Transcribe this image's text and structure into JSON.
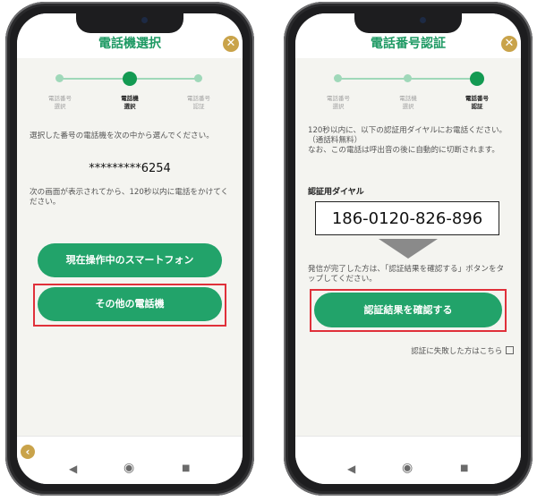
{
  "left": {
    "title": "電話機選択",
    "steps": [
      {
        "label": "電話番号\n選択",
        "active": false
      },
      {
        "label": "電話機\n選択",
        "active": true
      },
      {
        "label": "電話番号\n認証",
        "active": false
      }
    ],
    "instruction": "選択した番号の電話機を次の中から選んでください。",
    "masked_number": "*********6254",
    "note": "次の画面が表示されてから、120秒以内に電話をかけてください。",
    "btn_current": "現在操作中のスマートフォン",
    "btn_other": "その他の電話機"
  },
  "right": {
    "title": "電話番号認証",
    "steps": [
      {
        "label": "電話番号\n選択",
        "active": false
      },
      {
        "label": "電話機\n選択",
        "active": false
      },
      {
        "label": "電話番号\n認証",
        "active": true
      }
    ],
    "instruction": "120秒以内に、以下の認証用ダイヤルにお電話ください。（通話料無料）\nなお、この電話は呼出音の後に自動的に切断されます。",
    "dial_label": "認証用ダイヤル",
    "dial_number": "186-0120-826-896",
    "after_call_note": "発信が完了した方は、「認証結果を確認する」ボタンをタップしてください。",
    "confirm_button": "認証結果を確認する",
    "failure_link": "認証に失敗した方はこちら"
  },
  "nav": {
    "back": "◀",
    "home": "◉",
    "recent": "■"
  },
  "icons": {
    "close": "close-icon",
    "back": "back-arrow-icon"
  },
  "colors": {
    "accent": "#22a36a",
    "title": "#1f9a64",
    "gold": "#c9a34a",
    "highlight": "#e0303a"
  }
}
